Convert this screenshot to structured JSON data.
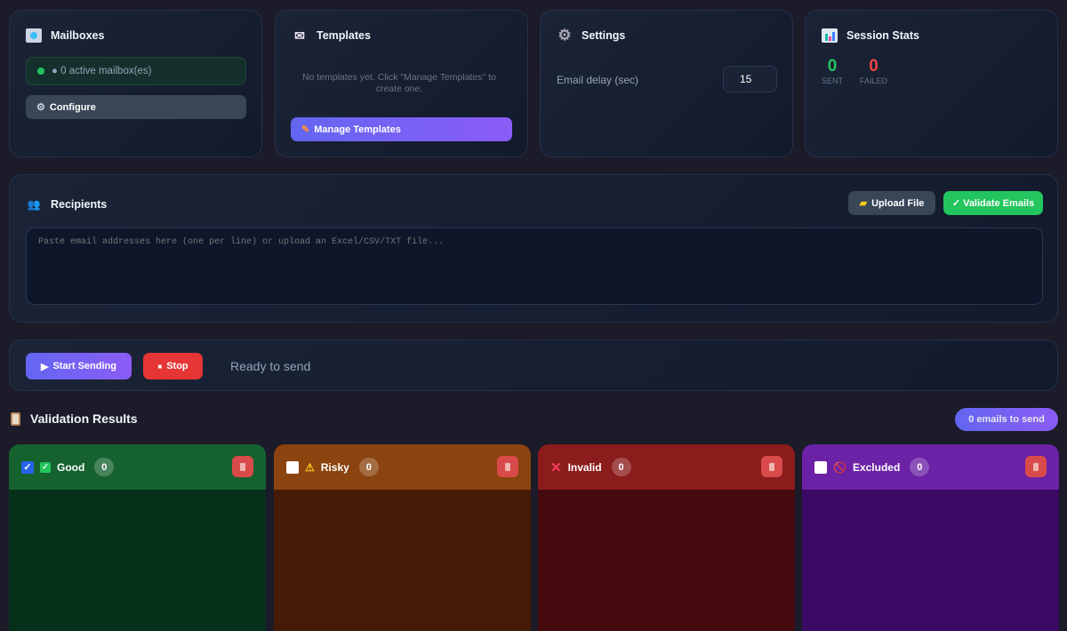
{
  "mailboxes": {
    "title": "Mailboxes",
    "status": "● 0 active mailbox(es)",
    "configure": "Configure"
  },
  "templates": {
    "title": "Templates",
    "empty": "No templates yet. Click \"Manage Templates\" to create one.",
    "manage": "Manage Templates"
  },
  "settings": {
    "title": "Settings",
    "delay_label": "Email delay (sec)",
    "delay_value": "15"
  },
  "stats": {
    "title": "Session Stats",
    "sent": "0",
    "sent_label": "SENT",
    "failed": "0",
    "failed_label": "FAILED"
  },
  "recipients": {
    "title": "Recipients",
    "upload": "Upload File",
    "validate": "✓ Validate Emails",
    "placeholder": "Paste email addresses here (one per line) or upload an Excel/CSV/TXT file..."
  },
  "controls": {
    "start": "Start Sending",
    "stop": "Stop",
    "status": "Ready to send"
  },
  "validation": {
    "title": "Validation Results",
    "badge": "0 emails to send",
    "columns": [
      {
        "label": "Good",
        "count": "0"
      },
      {
        "label": "Risky",
        "count": "0"
      },
      {
        "label": "Invalid",
        "count": "0"
      },
      {
        "label": "Excluded",
        "count": "0"
      }
    ]
  }
}
